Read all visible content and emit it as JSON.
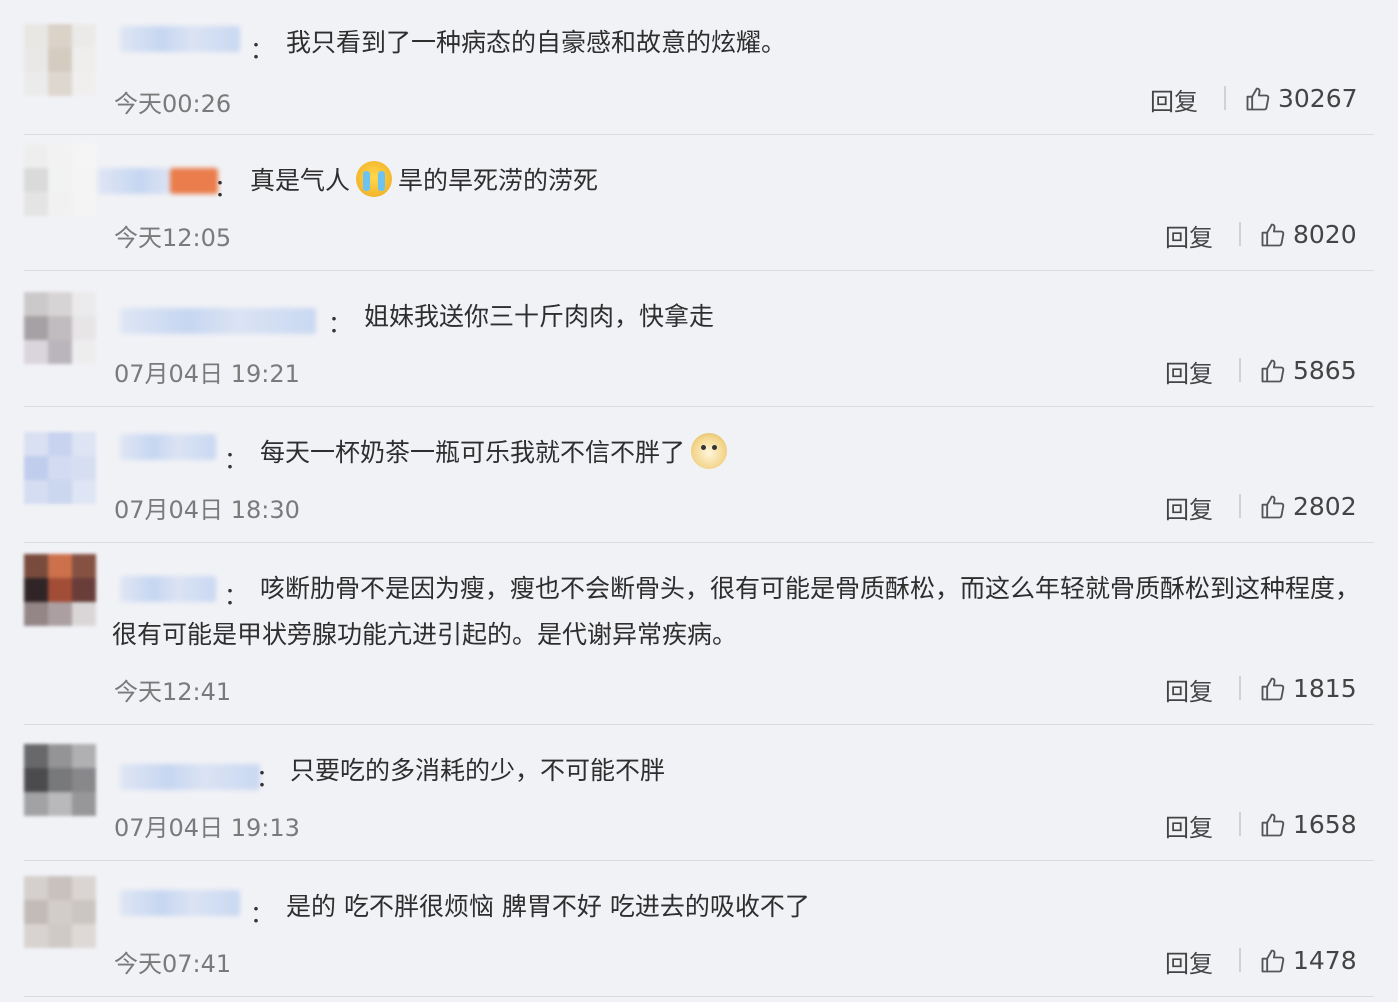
{
  "comments": [
    {
      "text": "我只看到了一种病态的自豪感和故意的炫耀。",
      "time": "今天00:26",
      "reply": "回复",
      "likes": "30267"
    },
    {
      "text_before": "真是气人",
      "emoji": "cry-face",
      "text_after": "旱的旱死涝的涝死",
      "time": "今天12:05",
      "reply": "回复",
      "likes": "8020"
    },
    {
      "text": "姐妹我送你三十斤肉肉，快拿走",
      "time": "07月04日 19:21",
      "reply": "回复",
      "likes": "5865"
    },
    {
      "text": "每天一杯奶茶一瓶可乐我就不信不胖了",
      "emoji": "doge-face",
      "time": "07月04日 18:30",
      "reply": "回复",
      "likes": "2802"
    },
    {
      "text": "咳断肋骨不是因为瘦，瘦也不会断骨头，很有可能是骨质酥松，而这么年轻就骨质酥松到这种程度，很有可能是甲状旁腺功能亢进引起的。是代谢异常疾病。",
      "time": "今天12:41",
      "reply": "回复",
      "likes": "1815"
    },
    {
      "text": "只要吃的多消耗的少，不可能不胖",
      "time": "07月04日 19:13",
      "reply": "回复",
      "likes": "1658"
    },
    {
      "text": "是的 吃不胖很烦恼 脾胃不好 吃进去的吸收不了",
      "time": "今天07:41",
      "reply": "回复",
      "likes": "1478"
    }
  ],
  "colon": "：",
  "icons": {
    "like": "thumbs-up-icon"
  }
}
